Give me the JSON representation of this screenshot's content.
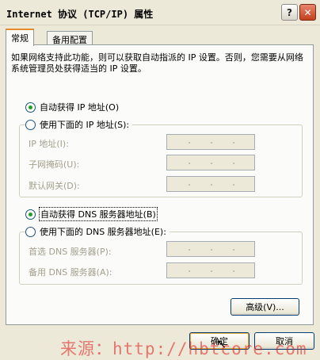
{
  "window": {
    "title": "Internet 协议 (TCP/IP) 属性",
    "help_glyph": "?",
    "close_glyph": "✕"
  },
  "tabs": [
    {
      "label": "常规",
      "active": true
    },
    {
      "label": "备用配置",
      "active": false
    }
  ],
  "intro": "如果网络支持此功能，则可以获取自动指派的 IP 设置。否则，您需要从网络系统管理员处获得适当的 IP 设置。",
  "ip": {
    "auto_label": "自动获得 IP 地址(O)",
    "auto_selected": true,
    "manual_label": "使用下面的 IP 地址(S):",
    "fields": [
      {
        "label": "IP 地址(I):",
        "value": ""
      },
      {
        "label": "子网掩码(U):",
        "value": ""
      },
      {
        "label": "默认网关(D):",
        "value": ""
      }
    ]
  },
  "dns": {
    "auto_label": "自动获得 DNS 服务器地址(B)",
    "auto_selected": true,
    "manual_label": "使用下面的 DNS 服务器地址(E):",
    "fields": [
      {
        "label": "首选 DNS 服务器(P):",
        "value": ""
      },
      {
        "label": "备用 DNS 服务器(A):",
        "value": ""
      }
    ]
  },
  "buttons": {
    "advanced": "高级(V)...",
    "ok": "确定",
    "cancel": "取消"
  },
  "watermark": "来源：http://hbtcore.com",
  "cursor_glyph": "↖"
}
